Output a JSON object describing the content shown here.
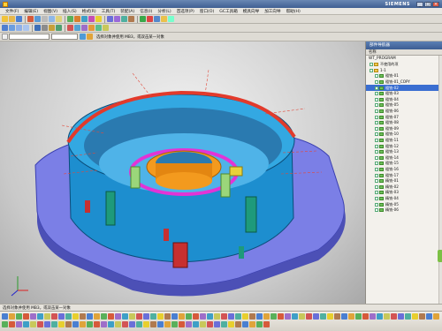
{
  "window": {
    "brand": "SIEMENS"
  },
  "menus": [
    "文件(F)",
    "编辑(E)",
    "视图(V)",
    "插入(S)",
    "格式(R)",
    "工具(T)",
    "装配(A)",
    "信息(I)",
    "分析(L)",
    "首选项(P)",
    "窗口(O)",
    "GC工具箱",
    "模具向导",
    "加工向导",
    "帮助(H)"
  ],
  "toolbar": {
    "hint": "选择对象并使用 MB3，或双击某一对象"
  },
  "panel": {
    "title": "部件导航器",
    "column_header": "名称",
    "root_node": "WT_PROGRAM",
    "tree": [
      {
        "label": "不使用的项"
      },
      {
        "label": "1-1"
      },
      {
        "label": "粗铣-01"
      },
      {
        "label": "粗铣-01_COPY"
      },
      {
        "label": "粗铣-02"
      },
      {
        "label": "粗铣-03"
      },
      {
        "label": "粗铣-04"
      },
      {
        "label": "粗铣-05"
      },
      {
        "label": "粗铣-06"
      },
      {
        "label": "粗铣-07"
      },
      {
        "label": "粗铣-08"
      },
      {
        "label": "粗铣-09"
      },
      {
        "label": "粗铣-10"
      },
      {
        "label": "粗铣-11"
      },
      {
        "label": "粗铣-12"
      },
      {
        "label": "粗铣-13"
      },
      {
        "label": "粗铣-14"
      },
      {
        "label": "粗铣-15"
      },
      {
        "label": "粗铣-16"
      },
      {
        "label": "粗铣-17"
      },
      {
        "label": "精铣-01"
      },
      {
        "label": "精铣-02"
      },
      {
        "label": "精铣-03"
      },
      {
        "label": "精铣-04"
      },
      {
        "label": "精铣-05"
      },
      {
        "label": "精铣-06"
      }
    ],
    "selected_index": 4
  },
  "status": {
    "prompt": "选择对象并使用 MB3，或双击某一对象"
  },
  "colors": {
    "platform": "#7b7fe6",
    "body": "#1d8ecf",
    "rim": "#e23a2b",
    "inner_ring": "#f39a1e",
    "magenta_ring": "#e234d6",
    "fixture": "#1e9a7a"
  }
}
